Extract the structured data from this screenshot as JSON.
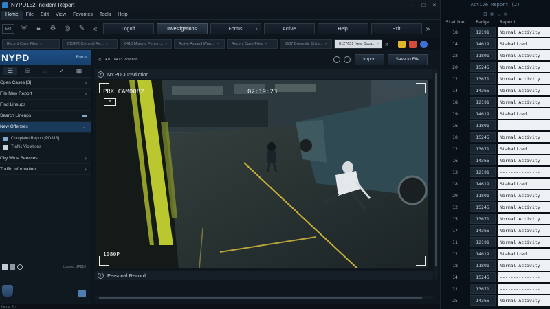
{
  "window": {
    "title": "NYPD152-Incident Report",
    "controls": [
      "–",
      "□",
      "×"
    ]
  },
  "menu": {
    "home": "Home",
    "items": [
      "File",
      "Edit",
      "View",
      "Favorites",
      "Tools",
      "Help"
    ]
  },
  "toolbar": {
    "exit_icon_label": "Exit",
    "nav_buttons": [
      {
        "label": "Logoff",
        "chevron": ""
      },
      {
        "label": "Investigations",
        "chevron": ""
      },
      {
        "label": "Forms",
        "chevron": "›"
      },
      {
        "label": "Active",
        "chevron": ""
      },
      {
        "label": "Help",
        "chevron": ""
      },
      {
        "label": "Exit",
        "chevron": ""
      }
    ],
    "back_chevron": "«",
    "forward_chevron": "»"
  },
  "doc_tabs": [
    {
      "label": "Recent Case Files",
      "active": false
    },
    {
      "label": "2B5472 Criminal Re...",
      "active": false
    },
    {
      "label": "0415 Missing Person...",
      "active": false
    },
    {
      "label": "Active Assault Warr...",
      "active": false
    },
    {
      "label": "Recent Case Files",
      "active": false
    },
    {
      "label": "3987 Domestic Distu...",
      "active": false
    },
    {
      "label": "0127651 New Docu...",
      "active": true
    }
  ],
  "sidebar": {
    "logo": "NYPD",
    "force": "Force",
    "items": [
      {
        "label": "Open Cases  [3]",
        "chevron": "›",
        "highlight": false
      },
      {
        "label": "File New Report",
        "chevron": "›",
        "highlight": false
      },
      {
        "label": "Find Lineups",
        "chevron": "",
        "highlight": false
      },
      {
        "label": "Search Lineups",
        "chevron": "",
        "highlight": false
      },
      {
        "label": "New Offenses",
        "chevron": "⌄",
        "highlight": true
      }
    ],
    "subitems": [
      "Complaint Report [PD313]",
      "Traffic Violations"
    ],
    "items2": [
      {
        "label": "City Wide Services",
        "chevron": "›"
      },
      {
        "label": "Traffic Information",
        "chevron": "›"
      }
    ],
    "logged": "Logged: JP819"
  },
  "content": {
    "breadcrumb": "0118473 Violation",
    "import_label": "Import",
    "save_label": "Save to File",
    "jurisdiction": "NYPD Jurisdiction",
    "personal_record": "Personal Record"
  },
  "feed": {
    "camera": "PRK CAM0082",
    "mode": "A",
    "time": "02:19:23",
    "resolution": "1080P"
  },
  "statusbar": {
    "text": "Items: 2  »"
  },
  "right_panel": {
    "title": "Active Report (2)",
    "headers": [
      "Station",
      "Badge",
      "Report"
    ],
    "rows": [
      [
        "18",
        "12191",
        "Normal Activity"
      ],
      [
        "14",
        "14619",
        "Stabalized"
      ],
      [
        "22",
        "11891",
        "Normal Activity"
      ],
      [
        "20",
        "15245",
        "Normal Activity"
      ],
      [
        "12",
        "13671",
        "Normal Activity"
      ],
      [
        "14",
        "14365",
        "Normal Activity"
      ],
      [
        "18",
        "12191",
        "Normal Activity"
      ],
      [
        "19",
        "14619",
        "Stabalized"
      ],
      [
        "16",
        "11891",
        "---------------"
      ],
      [
        "10",
        "15245",
        "Normal Activity"
      ],
      [
        "12",
        "13671",
        "Stabalized"
      ],
      [
        "16",
        "14365",
        "Normal Activity"
      ],
      [
        "13",
        "12191",
        "---------------"
      ],
      [
        "18",
        "14619",
        "Stabalized"
      ],
      [
        "29",
        "11891",
        "Normal Activity"
      ],
      [
        "12",
        "15245",
        "Normal Activity"
      ],
      [
        "15",
        "13671",
        "Normal Activity"
      ],
      [
        "17",
        "14365",
        "Normal Activity"
      ],
      [
        "11",
        "12191",
        "Normal Activity"
      ],
      [
        "12",
        "14619",
        "Stabalized"
      ],
      [
        "18",
        "11891",
        "Normal Activity"
      ],
      [
        "14",
        "15245",
        "---------------"
      ],
      [
        "21",
        "13671",
        "---------------"
      ],
      [
        "25",
        "14365",
        "Normal Activity"
      ]
    ]
  }
}
